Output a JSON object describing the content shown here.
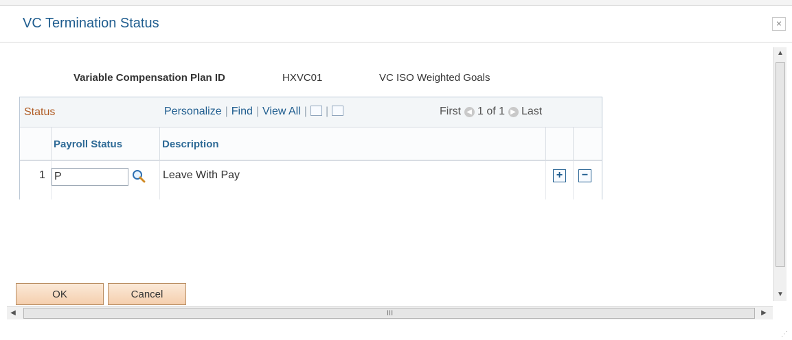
{
  "dialog": {
    "title": "VC Termination Status",
    "close_icon": "×"
  },
  "plan": {
    "label": "Variable Compensation Plan ID",
    "id": "HXVC01",
    "description": "VC ISO Weighted Goals"
  },
  "grid": {
    "title": "Status",
    "links": {
      "personalize": "Personalize",
      "find": "Find",
      "view_all": "View All"
    },
    "pager": {
      "first": "First",
      "range": "1 of 1",
      "last": "Last"
    },
    "columns": [
      "Payroll Status",
      "Description"
    ],
    "rows": [
      {
        "num": "1",
        "payroll_status": "P",
        "description": "Leave With Pay"
      }
    ]
  },
  "buttons": {
    "ok": "OK",
    "cancel": "Cancel"
  },
  "icons": {
    "close": "close-icon",
    "zoom": "zoom-icon",
    "download": "download-icon",
    "lookup": "search-icon",
    "add_row": "plus-icon",
    "delete_row": "minus-icon",
    "prev": "chevron-left-icon",
    "next": "chevron-right-icon"
  },
  "scroll": {
    "h_label": "III"
  },
  "colors": {
    "title": "#1f5d8f",
    "grid_title": "#b05b23",
    "link": "#1f5d8f",
    "button_fill": "#f5cfae"
  }
}
